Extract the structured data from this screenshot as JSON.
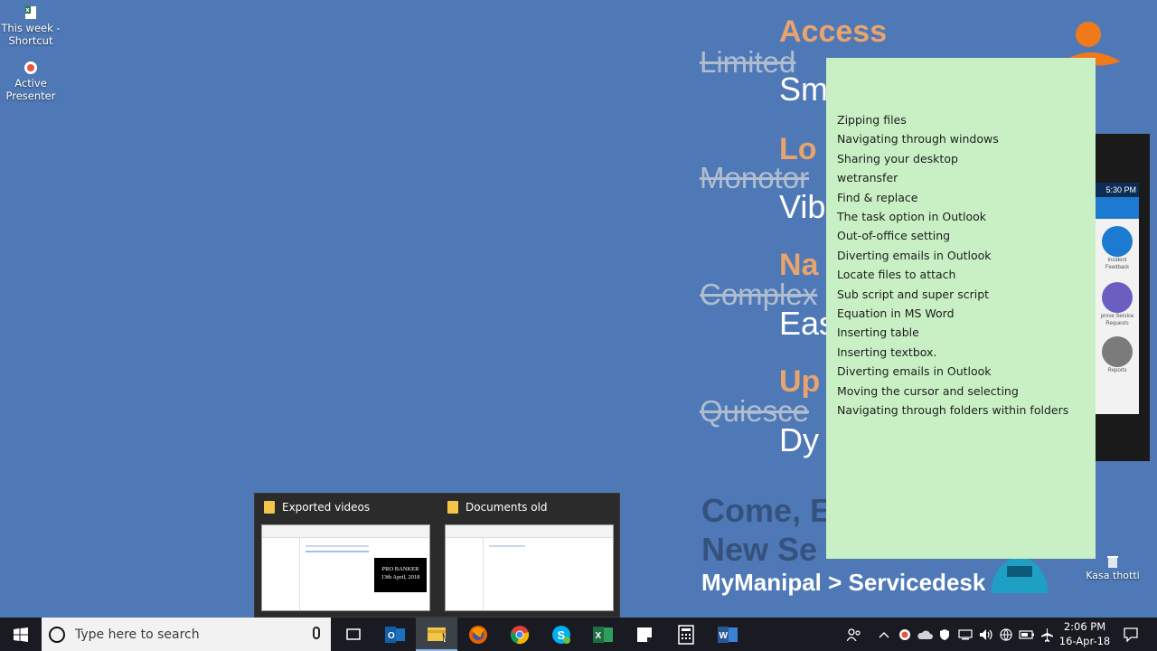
{
  "desktop": {
    "icons": [
      {
        "label": "This week - Shortcut",
        "icon": "excel-shortcut-icon"
      },
      {
        "label": "Active Presenter",
        "icon": "activepresenter-icon"
      }
    ],
    "recycle_bin": {
      "label": "Kasa thotti",
      "icon": "recycle-bin-icon"
    }
  },
  "wallpaper": {
    "headings": [
      "Access",
      "Lo",
      "Na",
      "Up"
    ],
    "struck": [
      "Limited",
      "Monotor",
      "Complex",
      "Quiesce"
    ],
    "replacement": [
      "Sm",
      "Vib",
      "Eas",
      "Dy"
    ],
    "bottom_lines": [
      "Come, E",
      "New Se",
      "MyManipal > Servicedesk"
    ],
    "phone": {
      "time": "5:30 PM",
      "apps": [
        "Incident Feedback",
        "prove Service Requests",
        "Reports"
      ]
    }
  },
  "sticky_note": {
    "items": [
      "Zipping files",
      "Navigating through windows",
      "Sharing your desktop",
      "wetransfer",
      "Find & replace",
      "The task option in Outlook",
      "Out-of-office setting",
      "Diverting emails in Outlook",
      "Locate files to attach",
      "Sub script and super script",
      "Equation in MS Word",
      "Inserting table",
      "Inserting textbox.",
      "Diverting emails in Outlook",
      "Moving the cursor and selecting",
      "Navigating through folders within folders"
    ]
  },
  "preview": {
    "windows": [
      {
        "title": "Exported videos",
        "thumb_text_1": "PRO BANKER",
        "thumb_text_2": "13th April, 2018"
      },
      {
        "title": "Documents old"
      }
    ]
  },
  "taskbar": {
    "search_placeholder": "Type here to search",
    "apps": [
      "outlook-icon",
      "file-explorer-icon",
      "firefox-icon",
      "chrome-icon",
      "skype-icon",
      "excel-icon",
      "sticky-notes-icon",
      "calculator-icon",
      "word-icon"
    ],
    "active_app": "file-explorer-icon",
    "time": "2:06 PM",
    "date": "16-Apr-18",
    "colors": {
      "taskbar": "#1a1b22",
      "desktop": "#4f79b6",
      "sticky": "#c9f0c4"
    }
  }
}
